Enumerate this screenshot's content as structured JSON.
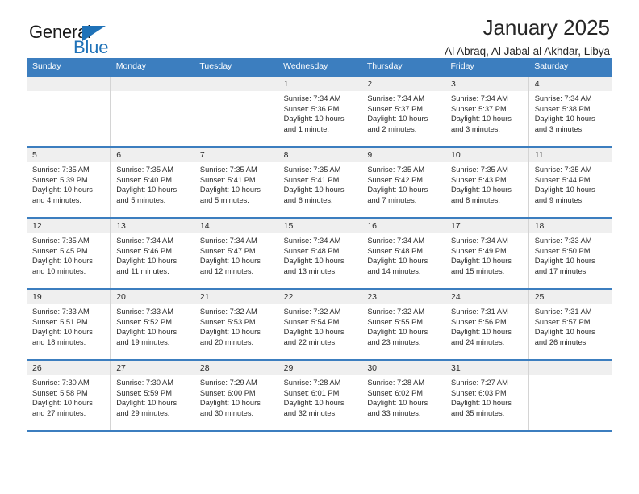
{
  "brand": {
    "name_top": "General",
    "name_bottom": "Blue",
    "triangle_color": "#1f72b8"
  },
  "header": {
    "title": "January 2025",
    "subtitle": "Al Abraq, Al Jabal al Akhdar, Libya"
  },
  "theme": {
    "header_blue": "#3c7ebf",
    "daynum_gray": "#efefef",
    "grid_gray": "#d4d4d4"
  },
  "weekdays": [
    "Sunday",
    "Monday",
    "Tuesday",
    "Wednesday",
    "Thursday",
    "Friday",
    "Saturday"
  ],
  "weeks": [
    [
      {
        "day": "",
        "sunrise": "",
        "sunset": "",
        "daylight1": "",
        "daylight2": "",
        "empty": true
      },
      {
        "day": "",
        "sunrise": "",
        "sunset": "",
        "daylight1": "",
        "daylight2": "",
        "empty": true
      },
      {
        "day": "",
        "sunrise": "",
        "sunset": "",
        "daylight1": "",
        "daylight2": "",
        "empty": true
      },
      {
        "day": "1",
        "sunrise": "Sunrise: 7:34 AM",
        "sunset": "Sunset: 5:36 PM",
        "daylight1": "Daylight: 10 hours",
        "daylight2": "and 1 minute."
      },
      {
        "day": "2",
        "sunrise": "Sunrise: 7:34 AM",
        "sunset": "Sunset: 5:37 PM",
        "daylight1": "Daylight: 10 hours",
        "daylight2": "and 2 minutes."
      },
      {
        "day": "3",
        "sunrise": "Sunrise: 7:34 AM",
        "sunset": "Sunset: 5:37 PM",
        "daylight1": "Daylight: 10 hours",
        "daylight2": "and 3 minutes."
      },
      {
        "day": "4",
        "sunrise": "Sunrise: 7:34 AM",
        "sunset": "Sunset: 5:38 PM",
        "daylight1": "Daylight: 10 hours",
        "daylight2": "and 3 minutes."
      }
    ],
    [
      {
        "day": "5",
        "sunrise": "Sunrise: 7:35 AM",
        "sunset": "Sunset: 5:39 PM",
        "daylight1": "Daylight: 10 hours",
        "daylight2": "and 4 minutes."
      },
      {
        "day": "6",
        "sunrise": "Sunrise: 7:35 AM",
        "sunset": "Sunset: 5:40 PM",
        "daylight1": "Daylight: 10 hours",
        "daylight2": "and 5 minutes."
      },
      {
        "day": "7",
        "sunrise": "Sunrise: 7:35 AM",
        "sunset": "Sunset: 5:41 PM",
        "daylight1": "Daylight: 10 hours",
        "daylight2": "and 5 minutes."
      },
      {
        "day": "8",
        "sunrise": "Sunrise: 7:35 AM",
        "sunset": "Sunset: 5:41 PM",
        "daylight1": "Daylight: 10 hours",
        "daylight2": "and 6 minutes."
      },
      {
        "day": "9",
        "sunrise": "Sunrise: 7:35 AM",
        "sunset": "Sunset: 5:42 PM",
        "daylight1": "Daylight: 10 hours",
        "daylight2": "and 7 minutes."
      },
      {
        "day": "10",
        "sunrise": "Sunrise: 7:35 AM",
        "sunset": "Sunset: 5:43 PM",
        "daylight1": "Daylight: 10 hours",
        "daylight2": "and 8 minutes."
      },
      {
        "day": "11",
        "sunrise": "Sunrise: 7:35 AM",
        "sunset": "Sunset: 5:44 PM",
        "daylight1": "Daylight: 10 hours",
        "daylight2": "and 9 minutes."
      }
    ],
    [
      {
        "day": "12",
        "sunrise": "Sunrise: 7:35 AM",
        "sunset": "Sunset: 5:45 PM",
        "daylight1": "Daylight: 10 hours",
        "daylight2": "and 10 minutes."
      },
      {
        "day": "13",
        "sunrise": "Sunrise: 7:34 AM",
        "sunset": "Sunset: 5:46 PM",
        "daylight1": "Daylight: 10 hours",
        "daylight2": "and 11 minutes."
      },
      {
        "day": "14",
        "sunrise": "Sunrise: 7:34 AM",
        "sunset": "Sunset: 5:47 PM",
        "daylight1": "Daylight: 10 hours",
        "daylight2": "and 12 minutes."
      },
      {
        "day": "15",
        "sunrise": "Sunrise: 7:34 AM",
        "sunset": "Sunset: 5:48 PM",
        "daylight1": "Daylight: 10 hours",
        "daylight2": "and 13 minutes."
      },
      {
        "day": "16",
        "sunrise": "Sunrise: 7:34 AM",
        "sunset": "Sunset: 5:48 PM",
        "daylight1": "Daylight: 10 hours",
        "daylight2": "and 14 minutes."
      },
      {
        "day": "17",
        "sunrise": "Sunrise: 7:34 AM",
        "sunset": "Sunset: 5:49 PM",
        "daylight1": "Daylight: 10 hours",
        "daylight2": "and 15 minutes."
      },
      {
        "day": "18",
        "sunrise": "Sunrise: 7:33 AM",
        "sunset": "Sunset: 5:50 PM",
        "daylight1": "Daylight: 10 hours",
        "daylight2": "and 17 minutes."
      }
    ],
    [
      {
        "day": "19",
        "sunrise": "Sunrise: 7:33 AM",
        "sunset": "Sunset: 5:51 PM",
        "daylight1": "Daylight: 10 hours",
        "daylight2": "and 18 minutes."
      },
      {
        "day": "20",
        "sunrise": "Sunrise: 7:33 AM",
        "sunset": "Sunset: 5:52 PM",
        "daylight1": "Daylight: 10 hours",
        "daylight2": "and 19 minutes."
      },
      {
        "day": "21",
        "sunrise": "Sunrise: 7:32 AM",
        "sunset": "Sunset: 5:53 PM",
        "daylight1": "Daylight: 10 hours",
        "daylight2": "and 20 minutes."
      },
      {
        "day": "22",
        "sunrise": "Sunrise: 7:32 AM",
        "sunset": "Sunset: 5:54 PM",
        "daylight1": "Daylight: 10 hours",
        "daylight2": "and 22 minutes."
      },
      {
        "day": "23",
        "sunrise": "Sunrise: 7:32 AM",
        "sunset": "Sunset: 5:55 PM",
        "daylight1": "Daylight: 10 hours",
        "daylight2": "and 23 minutes."
      },
      {
        "day": "24",
        "sunrise": "Sunrise: 7:31 AM",
        "sunset": "Sunset: 5:56 PM",
        "daylight1": "Daylight: 10 hours",
        "daylight2": "and 24 minutes."
      },
      {
        "day": "25",
        "sunrise": "Sunrise: 7:31 AM",
        "sunset": "Sunset: 5:57 PM",
        "daylight1": "Daylight: 10 hours",
        "daylight2": "and 26 minutes."
      }
    ],
    [
      {
        "day": "26",
        "sunrise": "Sunrise: 7:30 AM",
        "sunset": "Sunset: 5:58 PM",
        "daylight1": "Daylight: 10 hours",
        "daylight2": "and 27 minutes."
      },
      {
        "day": "27",
        "sunrise": "Sunrise: 7:30 AM",
        "sunset": "Sunset: 5:59 PM",
        "daylight1": "Daylight: 10 hours",
        "daylight2": "and 29 minutes."
      },
      {
        "day": "28",
        "sunrise": "Sunrise: 7:29 AM",
        "sunset": "Sunset: 6:00 PM",
        "daylight1": "Daylight: 10 hours",
        "daylight2": "and 30 minutes."
      },
      {
        "day": "29",
        "sunrise": "Sunrise: 7:28 AM",
        "sunset": "Sunset: 6:01 PM",
        "daylight1": "Daylight: 10 hours",
        "daylight2": "and 32 minutes."
      },
      {
        "day": "30",
        "sunrise": "Sunrise: 7:28 AM",
        "sunset": "Sunset: 6:02 PM",
        "daylight1": "Daylight: 10 hours",
        "daylight2": "and 33 minutes."
      },
      {
        "day": "31",
        "sunrise": "Sunrise: 7:27 AM",
        "sunset": "Sunset: 6:03 PM",
        "daylight1": "Daylight: 10 hours",
        "daylight2": "and 35 minutes."
      },
      {
        "day": "",
        "sunrise": "",
        "sunset": "",
        "daylight1": "",
        "daylight2": "",
        "empty": true
      }
    ]
  ]
}
